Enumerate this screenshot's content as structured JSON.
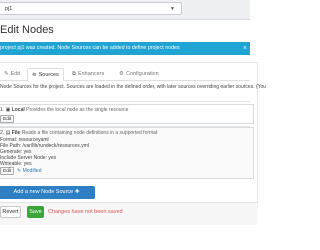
{
  "header": {
    "project_value": "pj1"
  },
  "page": {
    "title": "Edit Nodes"
  },
  "alert": {
    "message": "project pj1 was created. Node Sources can be added to define project nodes"
  },
  "tabs": [
    {
      "label": "Edit",
      "icon": "pencil-icon"
    },
    {
      "label": "Sources",
      "icon": "stack-icon",
      "active": true
    },
    {
      "label": "Enhancers",
      "icon": "layers-icon"
    },
    {
      "label": "Configuration",
      "icon": "gear-icon"
    }
  ],
  "sources": {
    "description": "Node Sources for the project. Sources are loaded in the defined order, with later sources overriding earlier sources. (You",
    "items": [
      {
        "index": "1.",
        "name": "Local",
        "summary": "Provides the local node as the single resource",
        "edit_label": "Edit"
      },
      {
        "index": "2.",
        "name": "File",
        "summary": "Reads a file containing node definitions in a supported format",
        "props": [
          "Format: resourceyaml",
          "File Path: /var/lib/rundeck/resources.yml",
          "Generate: yes",
          "Include Server Node: yes",
          "Writeable: yes"
        ],
        "edit_label": "Edit",
        "modified_label": "Modified"
      }
    ],
    "add_label": "Add a new Node Source"
  },
  "footer": {
    "revert_label": "Revert",
    "save_label": "Save",
    "unsaved_text": "Changes have not been saved"
  },
  "colors": {
    "alert": "#1fa4d4",
    "primary": "#2f7fc4",
    "success": "#3aa53a",
    "danger": "#d9534f"
  }
}
